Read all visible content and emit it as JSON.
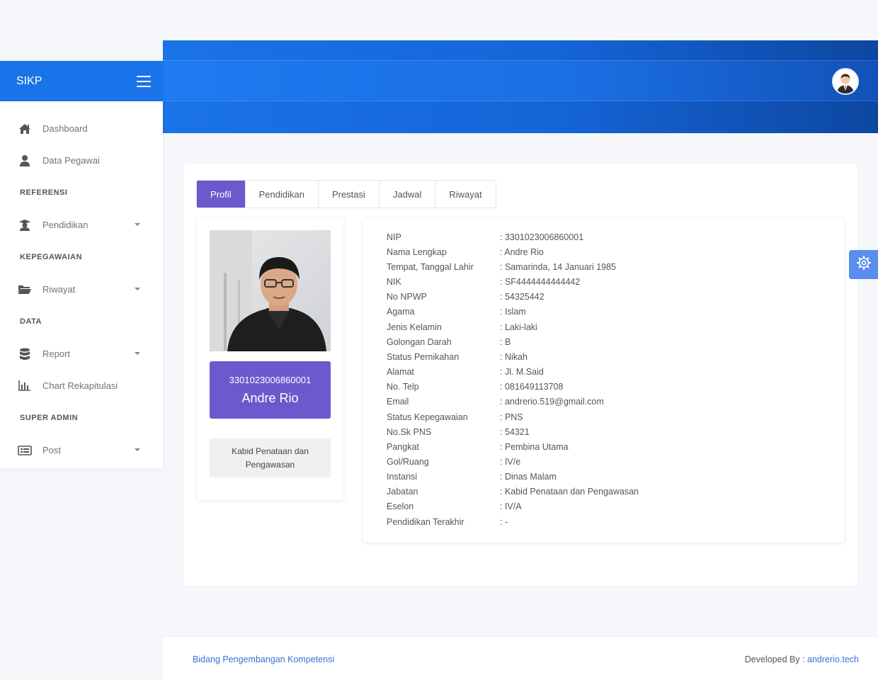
{
  "app": {
    "title": "SIKP"
  },
  "sidebar": {
    "items": [
      {
        "type": "link",
        "label": "Dashboard",
        "icon": "home-icon"
      },
      {
        "type": "link",
        "label": "Data Pegawai",
        "icon": "user-icon"
      },
      {
        "type": "heading",
        "label": "REFERENSI"
      },
      {
        "type": "dropdown",
        "label": "Pendidikan",
        "icon": "graduate-icon"
      },
      {
        "type": "heading",
        "label": "KEPEGAWAIAN"
      },
      {
        "type": "dropdown",
        "label": "Riwayat",
        "icon": "folder-icon"
      },
      {
        "type": "heading",
        "label": "DATA"
      },
      {
        "type": "dropdown",
        "label": "Report",
        "icon": "database-icon"
      },
      {
        "type": "link",
        "label": "Chart Rekapitulasi",
        "icon": "bar-chart-icon"
      },
      {
        "type": "heading",
        "label": "SUPER ADMIN"
      },
      {
        "type": "dropdown",
        "label": "Post",
        "icon": "list-alt-icon"
      }
    ]
  },
  "tabs": [
    {
      "label": "Profil",
      "active": true
    },
    {
      "label": "Pendidikan",
      "active": false
    },
    {
      "label": "Prestasi",
      "active": false
    },
    {
      "label": "Jadwal",
      "active": false
    },
    {
      "label": "Riwayat",
      "active": false
    }
  ],
  "profile": {
    "nip": "3301023006860001",
    "name": "Andre Rio",
    "position": "Kabid Penataan dan Pengawasan"
  },
  "details": [
    {
      "key": "NIP",
      "value": ": 3301023006860001"
    },
    {
      "key": "Nama Lengkap",
      "value": ": Andre Rio"
    },
    {
      "key": "Tempat, Tanggal Lahir",
      "value": ": Samarinda, 14 Januari 1985"
    },
    {
      "key": "NIK",
      "value": ": SF4444444444442"
    },
    {
      "key": "No NPWP",
      "value": ": 54325442"
    },
    {
      "key": "Agama",
      "value": ": Islam"
    },
    {
      "key": "Jenis Kelamin",
      "value": ": Laki-laki"
    },
    {
      "key": "Golongan Darah",
      "value": ": B"
    },
    {
      "key": "Status Pernikahan",
      "value": ": Nikah"
    },
    {
      "key": "Alamat",
      "value": ": Jl. M.Said"
    },
    {
      "key": "No. Telp",
      "value": ": 081649113708"
    },
    {
      "key": "Email",
      "value": ": andrerio.519@gmail.com"
    },
    {
      "key": "Status Kepegawaian",
      "value": ": PNS"
    },
    {
      "key": "No.Sk PNS",
      "value": ": 54321"
    },
    {
      "key": "Pangkat",
      "value": ": Pembina Utama"
    },
    {
      "key": "Gol/Ruang",
      "value": ": IV/e"
    },
    {
      "key": "Instansi",
      "value": ": Dinas Malam"
    },
    {
      "key": "Jabatan",
      "value": ": Kabid Penataan dan Pengawasan"
    },
    {
      "key": "Eselon",
      "value": ": IV/A"
    },
    {
      "key": "Pendidikan Terakhir",
      "value": ": -"
    }
  ],
  "footer": {
    "left": "Bidang Pengembangan Kompetensi",
    "right_prefix": "Developed By :",
    "right_link": "andrerio.tech"
  },
  "colors": {
    "primary": "#1a73e8",
    "accent": "#6a5acd",
    "settings": "#5b8def"
  },
  "icons": {
    "menu": "hamburger-icon",
    "settings": "gear-icon",
    "avatar": "user-avatar"
  }
}
